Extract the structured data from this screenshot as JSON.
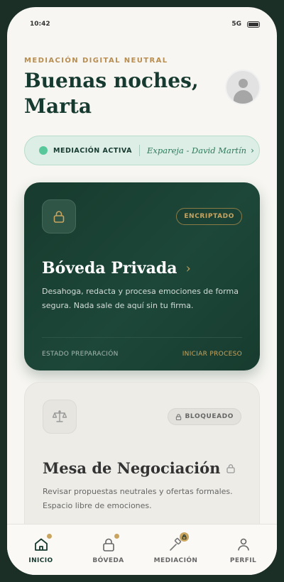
{
  "status_bar": {
    "time": "10:42",
    "network": "5G"
  },
  "header": {
    "eyebrow": "MEDIACIÓN DIGITAL NEUTRAL",
    "greeting": "Buenas noches, Marta",
    "avatar_icon": "user-silhouette-icon"
  },
  "mediation": {
    "status": "MEDIACIÓN ACTIVA",
    "partner": "Expareja - David Martín",
    "chevron": "›",
    "dot_color": "#58c79a"
  },
  "vault_card": {
    "icon": "lock-icon",
    "badge": "ENCRIPTADO",
    "title": "Bóveda Privada",
    "chevron": "›",
    "description": "Desahoga, redacta y procesa emociones de forma segura. Nada sale de aquí sin tu firma.",
    "footer_left": "ESTADO PREPARACIÓN",
    "footer_right": "INICIAR PROCESO",
    "background": "#173b2e",
    "accent": "#c9a45e"
  },
  "negotiation_card": {
    "icon": "scales-icon",
    "badge": "BLOQUEADO",
    "badge_icon": "lock-icon",
    "title": "Mesa de Negociación",
    "title_icon": "lock-icon",
    "description": "Revisar propuestas neutrales y ofertas formales. Espacio libre de emociones."
  },
  "nav": {
    "items": [
      {
        "label": "INICIO",
        "icon": "home-icon",
        "active": true
      },
      {
        "label": "BÓVEDA",
        "icon": "lock-icon",
        "active": false
      },
      {
        "label": "MEDIACIÓN",
        "icon": "gavel-icon",
        "active": false
      },
      {
        "label": "PERFIL",
        "icon": "person-icon",
        "active": false
      }
    ]
  }
}
